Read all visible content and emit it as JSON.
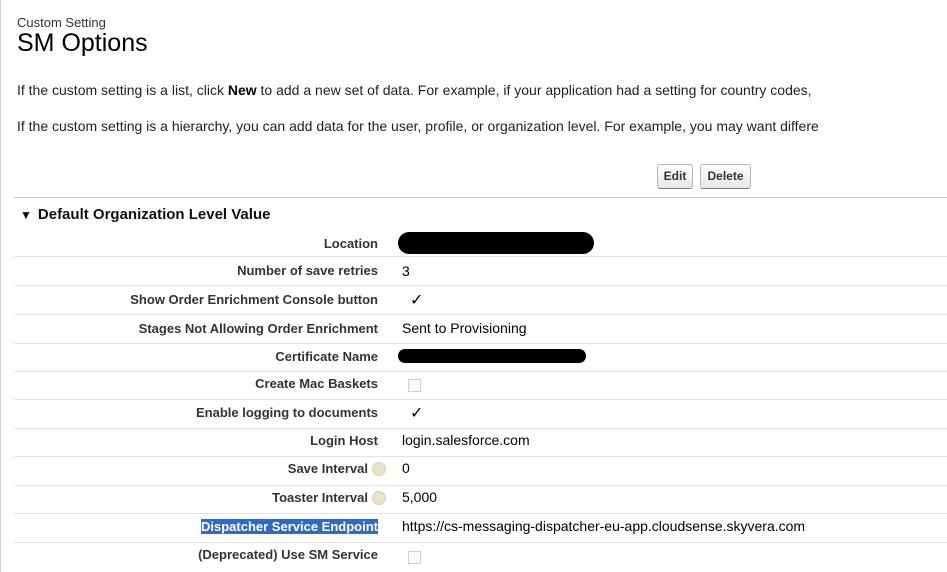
{
  "header": {
    "subtitle": "Custom Setting",
    "title": "SM Options"
  },
  "intro": {
    "para1_before": "If the custom setting is a list, click ",
    "para1_bold": "New",
    "para1_after": " to add a new set of data. For example, if your application had a setting for country codes,",
    "para2": "If the custom setting is a hierarchy, you can add data for the user, profile, or organization level. For example, you may want differe"
  },
  "buttons": {
    "edit": "Edit",
    "delete": "Delete"
  },
  "section": {
    "title": "Default Organization Level Value"
  },
  "fields": {
    "location": {
      "label": "Location"
    },
    "save_retries": {
      "label": "Number of save retries",
      "value": "3"
    },
    "show_console": {
      "label": "Show Order Enrichment Console button",
      "checked": true
    },
    "stages": {
      "label": "Stages Not Allowing Order Enrichment",
      "value": "Sent to Provisioning"
    },
    "certificate": {
      "label": "Certificate Name"
    },
    "mac_baskets": {
      "label": "Create Mac Baskets",
      "checked": false
    },
    "logging": {
      "label": "Enable logging to documents",
      "checked": true
    },
    "login_host": {
      "label": "Login Host",
      "value": "login.salesforce.com"
    },
    "save_interval": {
      "label": "Save Interval",
      "value": "0"
    },
    "toaster_interval": {
      "label": "Toaster Interval",
      "value": "5,000"
    },
    "dispatcher": {
      "label": "Dispatcher Service Endpoint",
      "value": "https://cs-messaging-dispatcher-eu-app.cloudsense.skyvera.com"
    },
    "use_sm_service": {
      "label": "(Deprecated) Use SM Service",
      "checked": false
    }
  },
  "glyphs": {
    "check": "✓",
    "triangle": "▼"
  },
  "colors": {
    "highlight": "#3169c6"
  }
}
